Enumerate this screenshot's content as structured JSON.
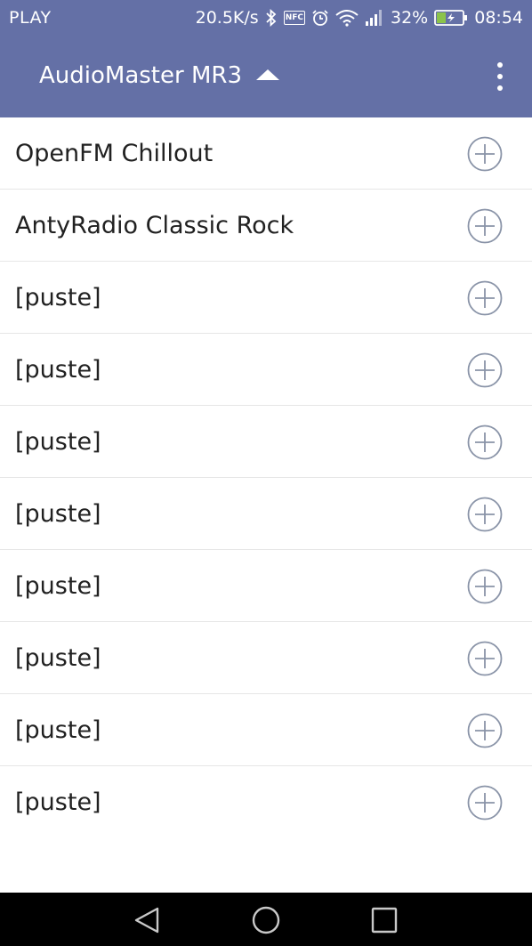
{
  "status_bar": {
    "carrier": "PLAY",
    "speed": "20.5K/s",
    "nfc": "NFC",
    "battery_percent": "32%",
    "time": "08:54",
    "icons": [
      "bluetooth-icon",
      "nfc-icon",
      "alarm-icon",
      "wifi-icon",
      "signal-icon",
      "battery-icon"
    ]
  },
  "app_bar": {
    "title": "AudioMaster MR3",
    "title_caret_icon": "caret-up-icon",
    "menu_icon": "overflow-menu-icon"
  },
  "stations": [
    {
      "label": "OpenFM Chillout",
      "action_icon": "add-circle-icon"
    },
    {
      "label": "AntyRadio Classic Rock",
      "action_icon": "add-circle-icon"
    },
    {
      "label": "[puste]",
      "action_icon": "add-circle-icon"
    },
    {
      "label": "[puste]",
      "action_icon": "add-circle-icon"
    },
    {
      "label": "[puste]",
      "action_icon": "add-circle-icon"
    },
    {
      "label": "[puste]",
      "action_icon": "add-circle-icon"
    },
    {
      "label": "[puste]",
      "action_icon": "add-circle-icon"
    },
    {
      "label": "[puste]",
      "action_icon": "add-circle-icon"
    },
    {
      "label": "[puste]",
      "action_icon": "add-circle-icon"
    },
    {
      "label": "[puste]",
      "action_icon": "add-circle-icon"
    }
  ],
  "nav_bar": {
    "back_icon": "back-triangle-icon",
    "home_icon": "home-circle-icon",
    "recents_icon": "recents-square-icon"
  },
  "colors": {
    "primary": "#6470a6",
    "text": "#212121",
    "divider": "#e6e6e6",
    "icon_outline": "#8a94a8",
    "battery_fill": "#8bc34a"
  }
}
